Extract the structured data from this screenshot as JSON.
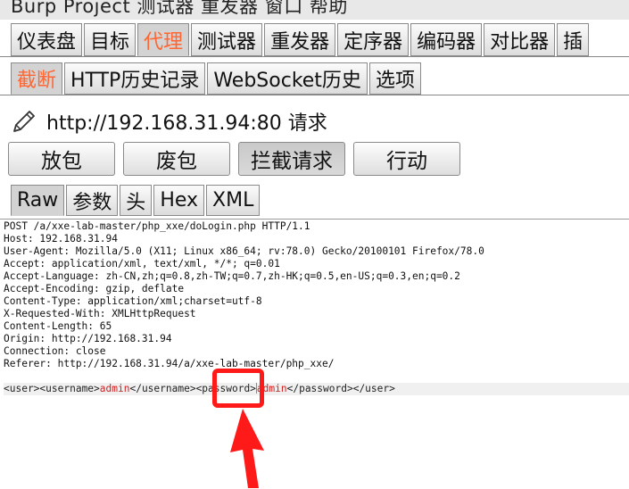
{
  "menubar": {
    "text": "Burp Project 测试器 重发器 窗口 帮助"
  },
  "main_tabs": [
    {
      "label": "仪表盘",
      "active": false
    },
    {
      "label": "目标",
      "active": false
    },
    {
      "label": "代理",
      "active": true
    },
    {
      "label": "测试器",
      "active": false
    },
    {
      "label": "重发器",
      "active": false
    },
    {
      "label": "定序器",
      "active": false
    },
    {
      "label": "编码器",
      "active": false
    },
    {
      "label": "对比器",
      "active": false
    },
    {
      "label": "插",
      "active": false
    }
  ],
  "proxy_tabs": [
    {
      "label": "截断",
      "active": true
    },
    {
      "label": "HTTP历史记录",
      "active": false
    },
    {
      "label": "WebSocket历史",
      "active": false
    },
    {
      "label": "选项",
      "active": false
    }
  ],
  "intercept": {
    "url_text": "http://192.168.31.94:80 请求"
  },
  "buttons": [
    {
      "label": "放包",
      "pressed": false
    },
    {
      "label": "废包",
      "pressed": false
    },
    {
      "label": "拦截请求",
      "pressed": true
    },
    {
      "label": "行动",
      "pressed": false
    }
  ],
  "view_tabs": [
    {
      "label": "Raw",
      "active": true
    },
    {
      "label": "参数",
      "active": false
    },
    {
      "label": "头",
      "active": false
    },
    {
      "label": "Hex",
      "active": false
    },
    {
      "label": "XML",
      "active": false
    }
  ],
  "request_lines": [
    "POST /a/xxe-lab-master/php_xxe/doLogin.php HTTP/1.1",
    "Host: 192.168.31.94",
    "User-Agent: Mozilla/5.0 (X11; Linux x86_64; rv:78.0) Gecko/20100101 Firefox/78.0",
    "Accept: application/xml, text/xml, */*; q=0.01",
    "Accept-Language: zh-CN,zh;q=0.8,zh-TW;q=0.7,zh-HK;q=0.5,en-US;q=0.3,en;q=0.2",
    "Accept-Encoding: gzip, deflate",
    "Content-Type: application/xml;charset=utf-8",
    "X-Requested-With: XMLHttpRequest",
    "Content-Length: 65",
    "Origin: http://192.168.31.94",
    "Connection: close",
    "Referer: http://192.168.31.94/a/xxe-lab-master/php_xxe/"
  ],
  "xml_body": {
    "open_user": "<user>",
    "open_username": "<username>",
    "username_value": "admin",
    "close_username": "</username>",
    "open_password": "<password>",
    "password_value": "admin",
    "close_password": "</password>",
    "close_user": "</user>"
  },
  "annotation": {
    "box_color": "#ff1a1a",
    "arrow_color": "#ff1a1a"
  },
  "colors": {
    "active_tab_text": "#ff6633",
    "xml_value": "#d02020",
    "caret": "#ff6600"
  }
}
